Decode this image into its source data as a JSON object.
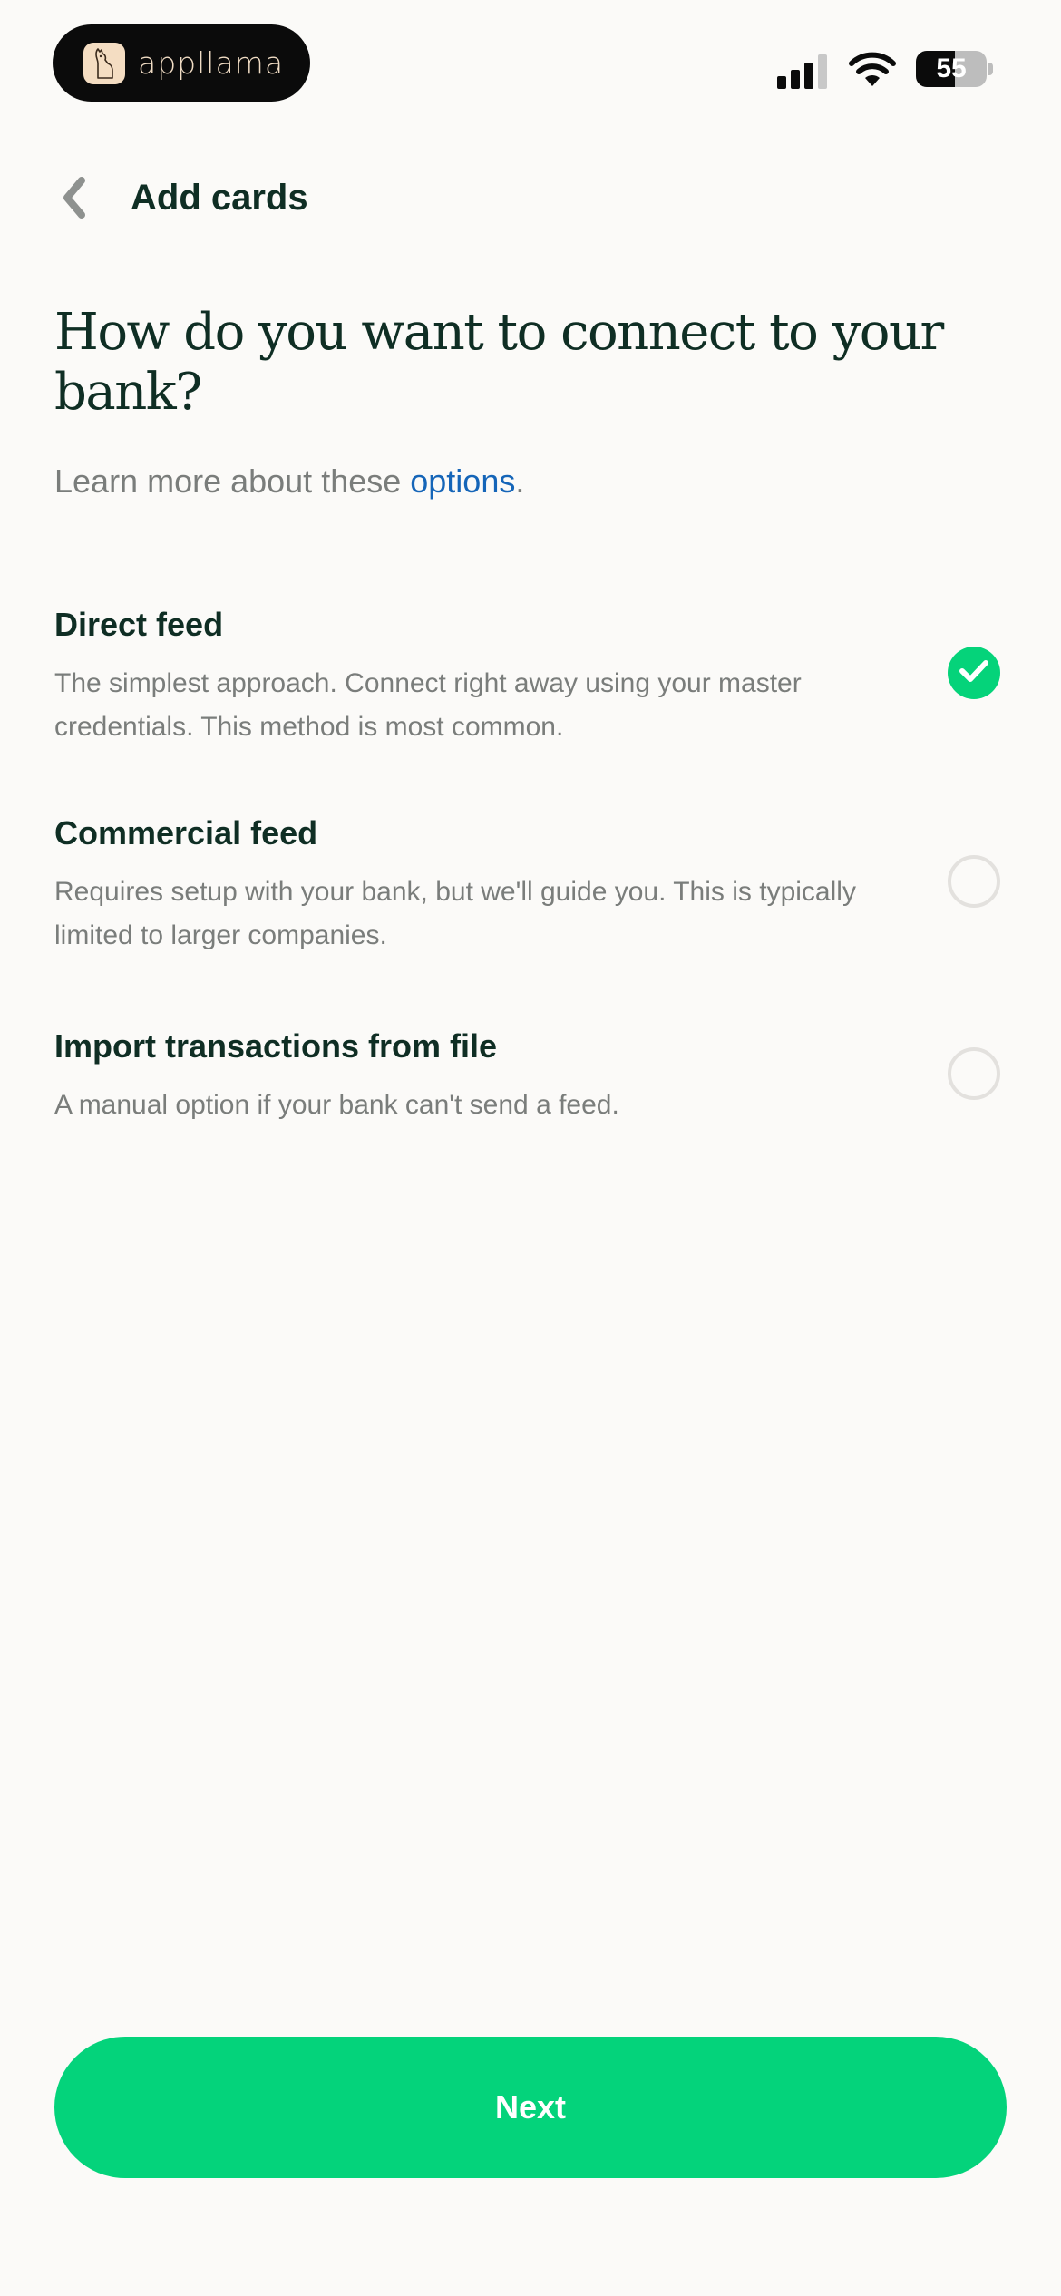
{
  "status_bar": {
    "brand_name": "appllama",
    "battery_level": "55",
    "battery_percent": 55
  },
  "nav": {
    "title": "Add cards"
  },
  "heading": "How do you want to connect to your bank?",
  "learn_more": {
    "prefix": "Learn more about these ",
    "link_text": "options",
    "suffix": "."
  },
  "options": [
    {
      "title": "Direct feed",
      "description": "The simplest approach. Connect right away using your master credentials. This method is most common.",
      "selected": true
    },
    {
      "title": "Commercial feed",
      "description": "Requires setup with your bank, but we'll guide you. This is typically limited to larger companies.",
      "selected": false
    },
    {
      "title": "Import transactions from file",
      "description": "A manual option if your bank can't send a feed.",
      "selected": false
    }
  ],
  "next_button": {
    "label": "Next"
  },
  "colors": {
    "accent_green": "#04D37B",
    "link_blue": "#1565B8",
    "heading_dark": "#0F2E24"
  }
}
